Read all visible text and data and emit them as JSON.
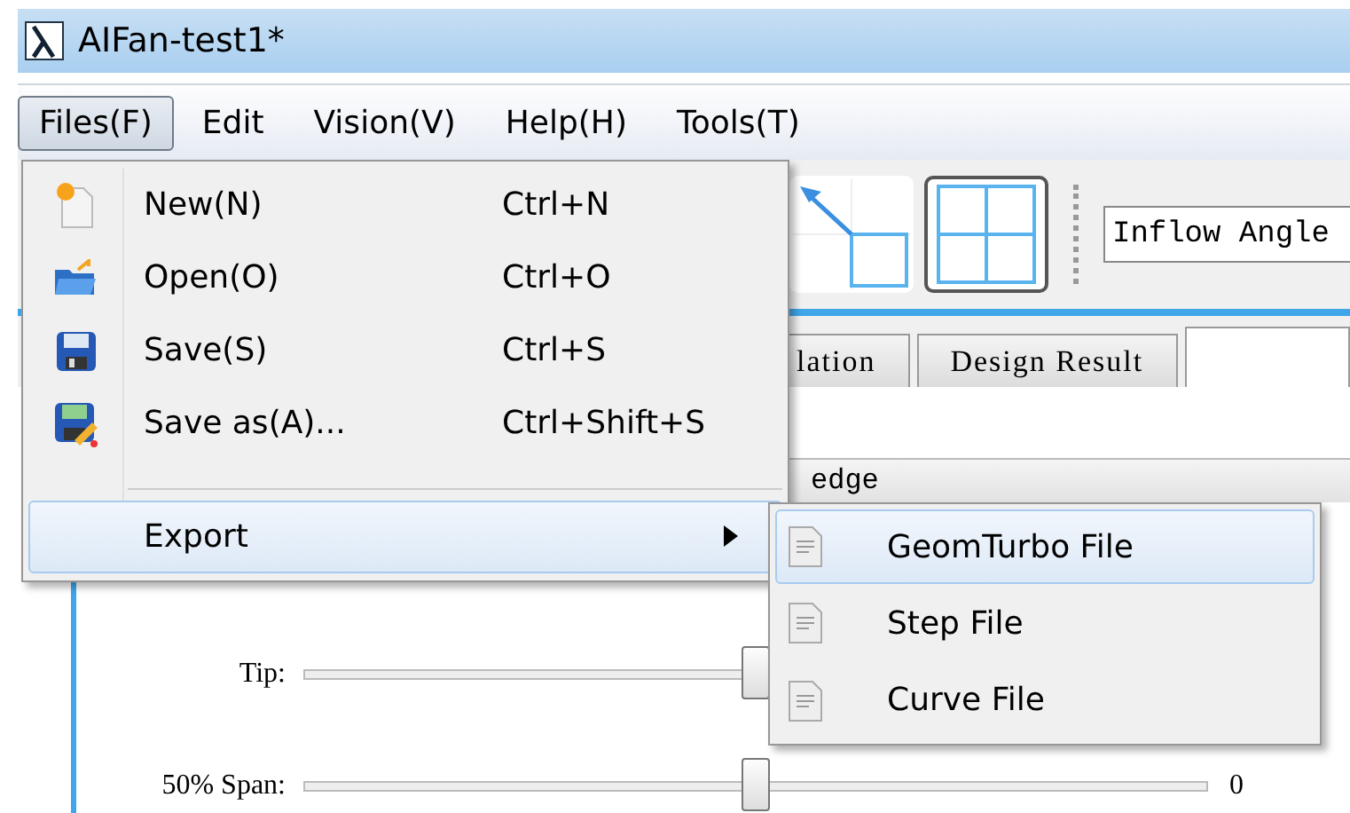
{
  "window": {
    "title": "AIFan-test1*"
  },
  "menubar": [
    {
      "label": "Files(F)",
      "selected": true
    },
    {
      "label": "Edit",
      "selected": false
    },
    {
      "label": "Vision(V)",
      "selected": false
    },
    {
      "label": "Help(H)",
      "selected": false
    },
    {
      "label": "Tools(T)",
      "selected": false
    }
  ],
  "files_menu": [
    {
      "kind": "command",
      "label": "New(N)",
      "shortcut": "Ctrl+N",
      "selected": false
    },
    {
      "kind": "command",
      "label": "Open(O)",
      "shortcut": "Ctrl+O",
      "selected": false
    },
    {
      "kind": "command",
      "label": "Save(S)",
      "shortcut": "Ctrl+S",
      "selected": false
    },
    {
      "kind": "command",
      "label": "Save as(A)...",
      "shortcut": "Ctrl+Shift+S",
      "selected": false
    },
    {
      "kind": "submenu",
      "label": "Export",
      "selected": true
    }
  ],
  "export_submenu": [
    {
      "label": "GeomTurbo File",
      "selected": true
    },
    {
      "label": "Step File",
      "selected": false
    },
    {
      "label": "Curve File",
      "selected": false
    }
  ],
  "toolbar": {
    "view_buttons": [
      {
        "kind": "diagonal",
        "selected": false
      },
      {
        "kind": "quad",
        "selected": true
      }
    ],
    "field": {
      "value": "Inflow Angle"
    }
  },
  "tabs": [
    {
      "label": "lation",
      "selected": false
    },
    {
      "label": "Design Result",
      "selected": false
    },
    {
      "selected": true
    }
  ],
  "table_header": {
    "column": "edge"
  },
  "sliders": [
    {
      "label": "Tip:",
      "level": 0.5
    },
    {
      "label": "50% Span:",
      "level": 0.5,
      "reading": "0"
    }
  ]
}
